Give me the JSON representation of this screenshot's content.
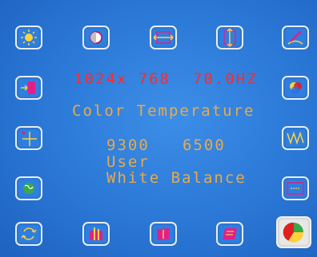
{
  "osd": {
    "resolution": "1024x 768",
    "refresh_rate": "70.0HZ",
    "menu_title": "Color Temperature",
    "options": [
      "9300",
      "6500",
      "User",
      "White Balance"
    ]
  },
  "icons": {
    "top": [
      "brightness-icon",
      "contrast-icon",
      "horizontal-size-icon",
      "vertical-size-icon",
      "pincushion-icon"
    ],
    "left": [
      "input-source-icon",
      "position-icon",
      "language-icon"
    ],
    "right": [
      "color-icon",
      "moire-icon",
      "horizontal-position-icon"
    ],
    "bottom": [
      "recall-icon",
      "trapezoid-icon",
      "tilt-icon",
      "parallelogram-icon",
      "pie-color-icon"
    ]
  },
  "colors": {
    "background": "#2a77d6",
    "resolution_text": "#ff2a2a",
    "menu_text": "#e8aa4a",
    "selected_button": "#e8e8e8"
  }
}
